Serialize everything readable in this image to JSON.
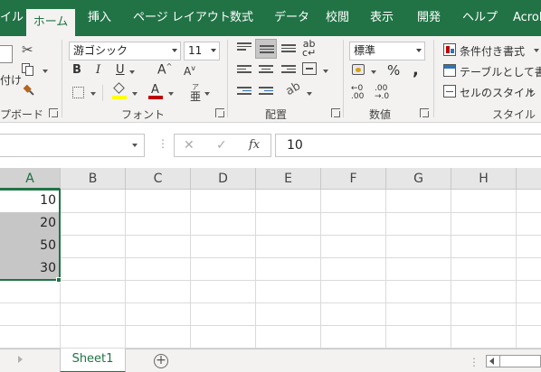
{
  "ribbon_tabs": [
    "イル",
    "ホーム",
    "挿入",
    "ページ レイアウト",
    "数式",
    "データ",
    "校閲",
    "表示",
    "開発",
    "ヘルプ",
    "Acrob"
  ],
  "active_tab": "ホーム",
  "clipboard": {
    "paste_label": "付け",
    "group_label": "プボード"
  },
  "font": {
    "name": "游ゴシック",
    "size": "11",
    "group_label": "フォント",
    "bold": "B",
    "italic": "I",
    "underline": "U",
    "grow": "A",
    "shrink": "A",
    "fill_letter": "",
    "font_color_letter": "A",
    "phonetic": "亜"
  },
  "alignment": {
    "group_label": "配置"
  },
  "number": {
    "format": "標準",
    "percent": "%",
    "comma": ",",
    "group_label": "数値",
    "inc_decimal_top": "←0",
    "inc_decimal_bottom": ".00",
    "dec_decimal_top": ".00",
    "dec_decimal_bottom": "→.0"
  },
  "styles": {
    "conditional": "条件付き書式",
    "table": "テーブルとして書式",
    "cell": "セルのスタイル",
    "group_label": "スタイル"
  },
  "formula_bar": {
    "fx": "fx",
    "value": "10",
    "cancel": "✕",
    "enter": "✓"
  },
  "columns": [
    "A",
    "B",
    "C",
    "D",
    "E",
    "F",
    "G",
    "H"
  ],
  "selected_column": "A",
  "cells_a": [
    "10",
    "20",
    "50",
    "30"
  ],
  "sheet_tab": "Sheet1",
  "add_sheet": "+",
  "colors": {
    "accent": "#217346",
    "selection": "#c6c6c6",
    "fill_swatch": "#ffff00",
    "font_swatch": "#c00000"
  }
}
